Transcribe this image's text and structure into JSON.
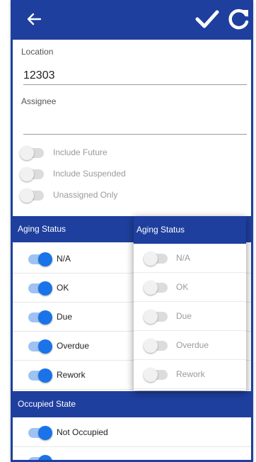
{
  "appbar": {
    "back_icon": "arrow-left-icon",
    "save_icon": "check-icon",
    "refresh_icon": "refresh-icon",
    "color": "#1f3f9e"
  },
  "location": {
    "label": "Location",
    "value": "12303"
  },
  "assignee": {
    "label": "Assignee",
    "value": ""
  },
  "options": [
    {
      "label": "Include Future",
      "on": false
    },
    {
      "label": "Include Suspended",
      "on": false
    },
    {
      "label": "Unassigned Only",
      "on": false
    }
  ],
  "aging_section": {
    "title": "Aging Status",
    "items": [
      {
        "label": "N/A",
        "on": true
      },
      {
        "label": "OK",
        "on": true
      },
      {
        "label": "Due",
        "on": true
      },
      {
        "label": "Overdue",
        "on": true
      },
      {
        "label": "Rework",
        "on": true
      }
    ]
  },
  "occupied_section": {
    "title": "Occupied State",
    "items": [
      {
        "label": "Not Occupied",
        "on": true
      }
    ]
  },
  "popup": {
    "title": "Aging Status",
    "items": [
      {
        "label": "N/A",
        "on": false
      },
      {
        "label": "OK",
        "on": false
      },
      {
        "label": "Due",
        "on": false
      },
      {
        "label": "Overdue",
        "on": false
      },
      {
        "label": "Rework",
        "on": false
      }
    ]
  }
}
